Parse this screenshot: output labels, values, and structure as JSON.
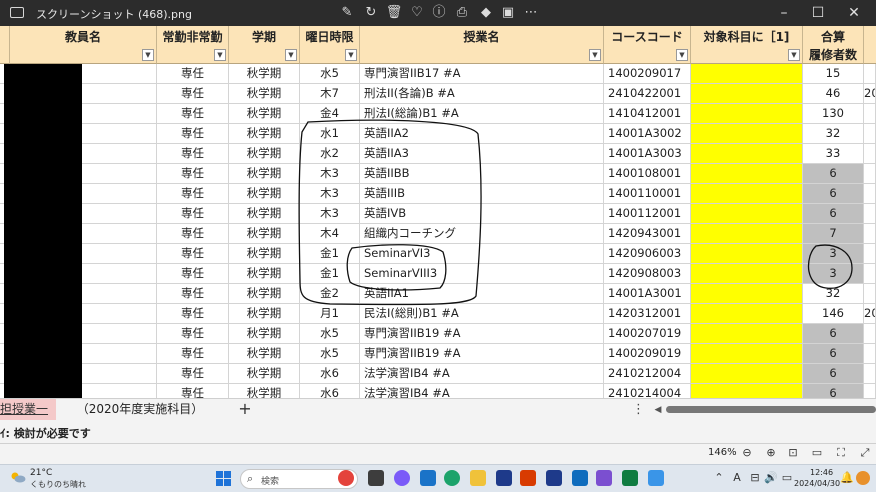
{
  "window": {
    "title": "スクリーンショット (468).png",
    "toolbar_icons": [
      "edit-icon",
      "rotate-icon",
      "delete-icon",
      "favorite-icon",
      "info-icon",
      "print-icon",
      "copilot-icon",
      "clipchamp-icon",
      "more-icon"
    ],
    "controls": [
      "minimize",
      "maximize",
      "close"
    ]
  },
  "sheet": {
    "headers": [
      {
        "line1": "教員名",
        "line2": ""
      },
      {
        "line1": "常勤非常勤",
        "line2": ""
      },
      {
        "line1": "学期",
        "line2": ""
      },
      {
        "line1": "曜日時限",
        "line2": ""
      },
      {
        "line1": "授業名",
        "line2": ""
      },
      {
        "line1": "コースコード",
        "line2": ""
      },
      {
        "line1": "対象科目に［1]",
        "line2": ""
      },
      {
        "line1": "合算",
        "line2": "履修者数"
      }
    ],
    "rows": [
      {
        "status": "専任",
        "term": "秋学期",
        "period": "水5",
        "course": "専門演習IIB17 #A",
        "code": "1400209017",
        "count": "15",
        "extra": "",
        "count_grey": false
      },
      {
        "status": "専任",
        "term": "秋学期",
        "period": "木7",
        "course": "刑法II(各論)B #A",
        "code": "2410422001",
        "count": "46",
        "extra": "20",
        "count_grey": false
      },
      {
        "status": "専任",
        "term": "秋学期",
        "period": "金4",
        "course": "刑法I(総論)B1 #A",
        "code": "1410412001",
        "count": "130",
        "extra": "",
        "count_grey": false
      },
      {
        "status": "専任",
        "term": "秋学期",
        "period": "水1",
        "course": "英語IIA2",
        "code": "14001A3002",
        "count": "32",
        "extra": "",
        "count_grey": false
      },
      {
        "status": "専任",
        "term": "秋学期",
        "period": "水2",
        "course": "英語IIA3",
        "code": "14001A3003",
        "count": "33",
        "extra": "",
        "count_grey": false
      },
      {
        "status": "専任",
        "term": "秋学期",
        "period": "木3",
        "course": "英語IIBB",
        "code": "1400108001",
        "count": "6",
        "extra": "",
        "count_grey": true
      },
      {
        "status": "専任",
        "term": "秋学期",
        "period": "木3",
        "course": "英語IIIB",
        "code": "1400110001",
        "count": "6",
        "extra": "",
        "count_grey": true
      },
      {
        "status": "専任",
        "term": "秋学期",
        "period": "木3",
        "course": "英語IVB",
        "code": "1400112001",
        "count": "6",
        "extra": "",
        "count_grey": true
      },
      {
        "status": "専任",
        "term": "秋学期",
        "period": "木4",
        "course": "組織内コーチング",
        "code": "1420943001",
        "count": "7",
        "extra": "",
        "count_grey": true
      },
      {
        "status": "専任",
        "term": "秋学期",
        "period": "金1",
        "course": "SeminarVI3",
        "code": "1420906003",
        "count": "3",
        "extra": "",
        "count_grey": true
      },
      {
        "status": "専任",
        "term": "秋学期",
        "period": "金1",
        "course": "SeminarVIII3",
        "code": "1420908003",
        "count": "3",
        "extra": "",
        "count_grey": true
      },
      {
        "status": "専任",
        "term": "秋学期",
        "period": "金2",
        "course": "英語IIA1",
        "code": "14001A3001",
        "count": "32",
        "extra": "",
        "count_grey": false
      },
      {
        "status": "専任",
        "term": "秋学期",
        "period": "月1",
        "course": "民法I(総則)B1 #A",
        "code": "1420312001",
        "count": "146",
        "extra": "20",
        "count_grey": false
      },
      {
        "status": "専任",
        "term": "秋学期",
        "period": "水5",
        "course": "専門演習IIB19 #A",
        "code": "1400207019",
        "count": "6",
        "extra": "",
        "count_grey": true
      },
      {
        "status": "専任",
        "term": "秋学期",
        "period": "水5",
        "course": "専門演習IIB19 #A",
        "code": "1400209019",
        "count": "6",
        "extra": "",
        "count_grey": true
      },
      {
        "status": "専任",
        "term": "秋学期",
        "period": "水6",
        "course": "法学演習IB4 #A",
        "code": "2410212004",
        "count": "6",
        "extra": "",
        "count_grey": true
      },
      {
        "status": "専任",
        "term": "秋学期",
        "period": "水6",
        "course": "法学演習IB4 #A",
        "code": "2410214004",
        "count": "6",
        "extra": "",
        "count_grey": true
      }
    ]
  },
  "tabs": {
    "active": "担授業一覧",
    "second": "（2020年度実施科目）",
    "add": "+",
    "more": "⋮"
  },
  "status": {
    "text": "ｲ: 検討が必要です",
    "zoom": "146%"
  },
  "taskbar": {
    "weather_temp": "21°C",
    "weather_desc": "くもりのち晴れ",
    "search_placeholder": "検索",
    "time": "12:46",
    "date": "2024/04/30",
    "tray_input": "A"
  },
  "colors": {
    "header_bg": "#fce4b8",
    "highlight_yellow": "#ffff00",
    "highlight_grey": "#bfbfbf",
    "titlebar": "#2c2c2c"
  }
}
